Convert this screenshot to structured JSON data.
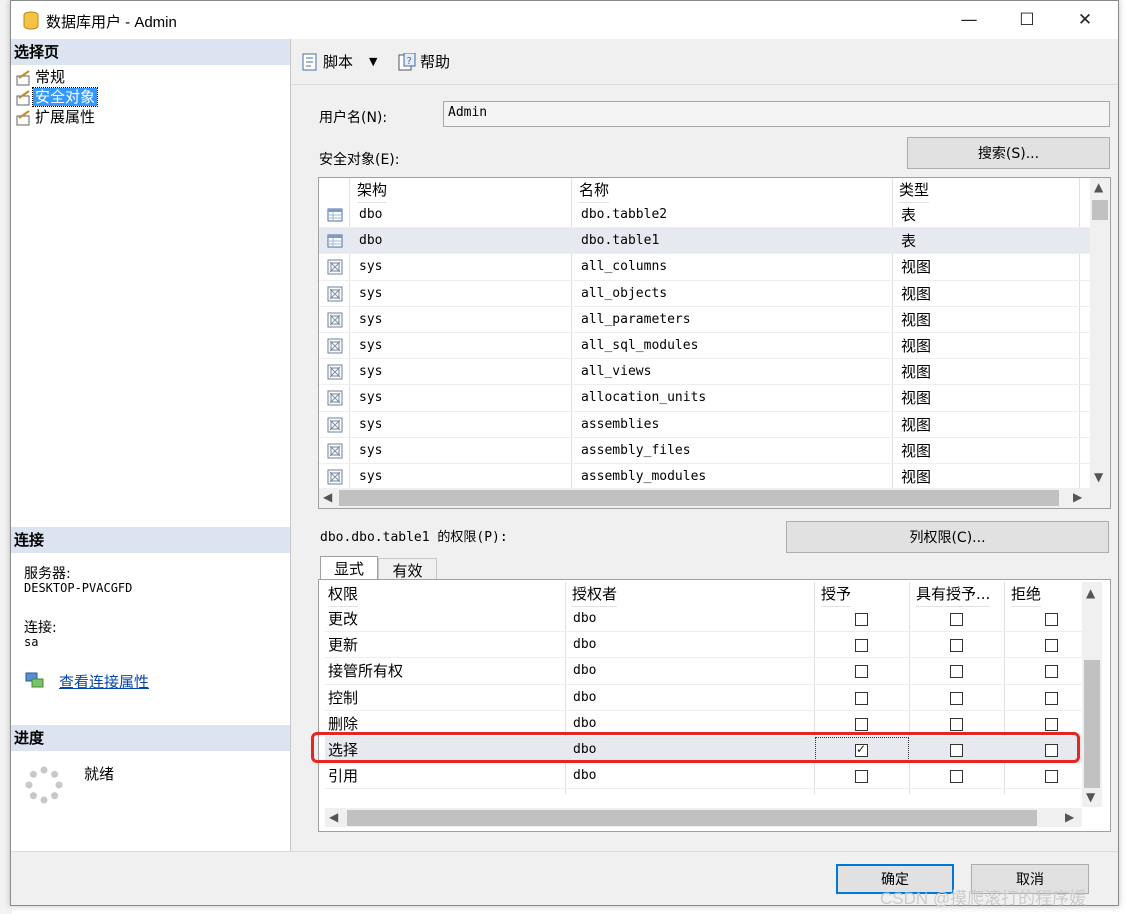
{
  "window": {
    "title": "数据库用户 - Admin"
  },
  "left": {
    "select_page_header": "选择页",
    "pages": [
      {
        "label": "常规",
        "selected": false
      },
      {
        "label": "安全对象",
        "selected": true
      },
      {
        "label": "扩展属性",
        "selected": false
      }
    ],
    "connection_header": "连接",
    "server_label": "服务器:",
    "server_value": "DESKTOP-PVACGFD",
    "connection_label": "连接:",
    "connection_value": "sa",
    "view_connection_link": "查看连接属性",
    "progress_header": "进度",
    "progress_status": "就绪"
  },
  "toolbar": {
    "script_label": "脚本",
    "help_label": "帮助"
  },
  "form": {
    "username_label": "用户名(N):",
    "username_value": "Admin",
    "securables_label": "安全对象(E):",
    "search_button": "搜索(S)..."
  },
  "securables_table": {
    "columns": [
      "架构",
      "名称",
      "类型"
    ],
    "rows": [
      {
        "schema": "dbo",
        "name": "dbo.tabble2",
        "type": "表",
        "icon": "table-icon"
      },
      {
        "schema": "dbo",
        "name": "dbo.table1",
        "type": "表",
        "icon": "table-icon",
        "selected": true
      },
      {
        "schema": "sys",
        "name": "all_columns",
        "type": "视图",
        "icon": "view-icon"
      },
      {
        "schema": "sys",
        "name": "all_objects",
        "type": "视图",
        "icon": "view-icon"
      },
      {
        "schema": "sys",
        "name": "all_parameters",
        "type": "视图",
        "icon": "view-icon"
      },
      {
        "schema": "sys",
        "name": "all_sql_modules",
        "type": "视图",
        "icon": "view-icon"
      },
      {
        "schema": "sys",
        "name": "all_views",
        "type": "视图",
        "icon": "view-icon"
      },
      {
        "schema": "sys",
        "name": "allocation_units",
        "type": "视图",
        "icon": "view-icon"
      },
      {
        "schema": "sys",
        "name": "assemblies",
        "type": "视图",
        "icon": "view-icon"
      },
      {
        "schema": "sys",
        "name": "assembly_files",
        "type": "视图",
        "icon": "view-icon"
      },
      {
        "schema": "sys",
        "name": "assembly_modules",
        "type": "视图",
        "icon": "view-icon"
      }
    ]
  },
  "permissions": {
    "label": "dbo.dbo.table1 的权限(P):",
    "column_perms_button": "列权限(C)...",
    "tabs": [
      "显式",
      "有效"
    ],
    "columns": [
      "权限",
      "授权者",
      "授予",
      "具有授予...",
      "拒绝"
    ],
    "rows": [
      {
        "permission": "更改",
        "grantor": "dbo",
        "grant": false,
        "with_grant": false,
        "deny": false
      },
      {
        "permission": "更新",
        "grantor": "dbo",
        "grant": false,
        "with_grant": false,
        "deny": false
      },
      {
        "permission": "接管所有权",
        "grantor": "dbo",
        "grant": false,
        "with_grant": false,
        "deny": false
      },
      {
        "permission": "控制",
        "grantor": "dbo",
        "grant": false,
        "with_grant": false,
        "deny": false
      },
      {
        "permission": "删除",
        "grantor": "dbo",
        "grant": false,
        "with_grant": false,
        "deny": false
      },
      {
        "permission": "选择",
        "grantor": "dbo",
        "grant": true,
        "with_grant": false,
        "deny": false,
        "highlighted": true
      },
      {
        "permission": "引用",
        "grantor": "dbo",
        "grant": false,
        "with_grant": false,
        "deny": false
      }
    ]
  },
  "footer": {
    "ok_button": "确定",
    "cancel_button": "取消"
  },
  "watermark": "CSDN @摸爬滚打的程序媛",
  "colors": {
    "highlight_border": "#e8261f",
    "selection_blue": "#3399ff",
    "section_header": "#dbe4f0"
  }
}
